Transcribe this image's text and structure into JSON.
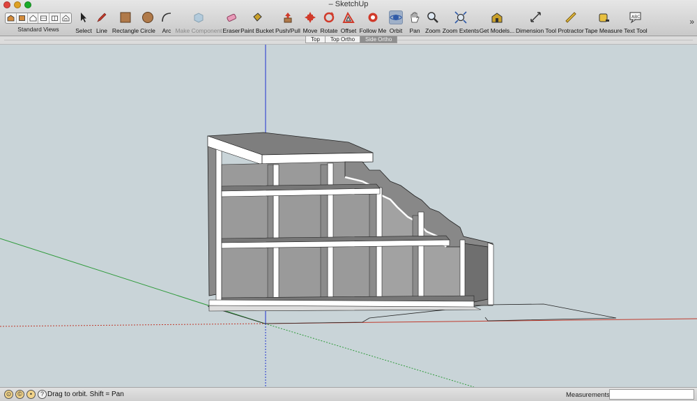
{
  "window": {
    "title": "– SketchUp",
    "title_redacted": true
  },
  "toolbar": {
    "standard_views_label": "Standard Views",
    "tools": [
      {
        "key": "select",
        "label": "Select",
        "icon": "arrow-cursor-icon"
      },
      {
        "key": "line",
        "label": "Line",
        "icon": "pencil-icon"
      },
      {
        "key": "rectangle",
        "label": "Rectangle",
        "icon": "rectangle-icon"
      },
      {
        "key": "circle",
        "label": "Circle",
        "icon": "circle-icon"
      },
      {
        "key": "arc",
        "label": "Arc",
        "icon": "arc-icon"
      },
      {
        "key": "make-component",
        "label": "Make Component",
        "icon": "component-icon",
        "disabled": true
      },
      {
        "key": "eraser",
        "label": "Eraser",
        "icon": "eraser-icon"
      },
      {
        "key": "paint-bucket",
        "label": "Paint Bucket",
        "icon": "paint-bucket-icon"
      },
      {
        "key": "push-pull",
        "label": "Push/Pull",
        "icon": "push-pull-icon"
      },
      {
        "key": "move",
        "label": "Move",
        "icon": "move-icon"
      },
      {
        "key": "rotate",
        "label": "Rotate",
        "icon": "rotate-icon"
      },
      {
        "key": "offset",
        "label": "Offset",
        "icon": "offset-icon"
      },
      {
        "key": "follow-me",
        "label": "Follow Me",
        "icon": "follow-me-icon"
      },
      {
        "key": "orbit",
        "label": "Orbit",
        "icon": "orbit-icon",
        "active": true
      },
      {
        "key": "pan",
        "label": "Pan",
        "icon": "hand-icon"
      },
      {
        "key": "zoom",
        "label": "Zoom",
        "icon": "magnifier-icon"
      },
      {
        "key": "zoom-extents",
        "label": "Zoom Extents",
        "icon": "zoom-extents-icon"
      },
      {
        "key": "get-models",
        "label": "Get Models...",
        "icon": "warehouse-icon"
      },
      {
        "key": "dimension",
        "label": "Dimension Tool",
        "icon": "dimension-icon"
      },
      {
        "key": "protractor",
        "label": "Protractor",
        "icon": "protractor-icon"
      },
      {
        "key": "tape-measure",
        "label": "Tape Measure",
        "icon": "tape-measure-icon"
      },
      {
        "key": "text",
        "label": "Text Tool",
        "icon": "text-tool-icon"
      }
    ],
    "overflow_label": "»"
  },
  "scenes": [
    {
      "label": "Top",
      "selected": false
    },
    {
      "label": "Top Ortho",
      "selected": false
    },
    {
      "label": "Side Ortho",
      "selected": true
    }
  ],
  "status": {
    "message": "Drag to orbit.  Shift = Pan",
    "measurements_label": "Measurements",
    "measurements_value": ""
  },
  "colors": {
    "sky": "#c9d4d8",
    "axis_red": "#c0392b",
    "axis_green": "#2e9a3a",
    "axis_blue": "#1d2fd0",
    "face_front": "#ffffff",
    "face_shade": "#8c8c8c",
    "face_dark": "#6f6f6f"
  }
}
